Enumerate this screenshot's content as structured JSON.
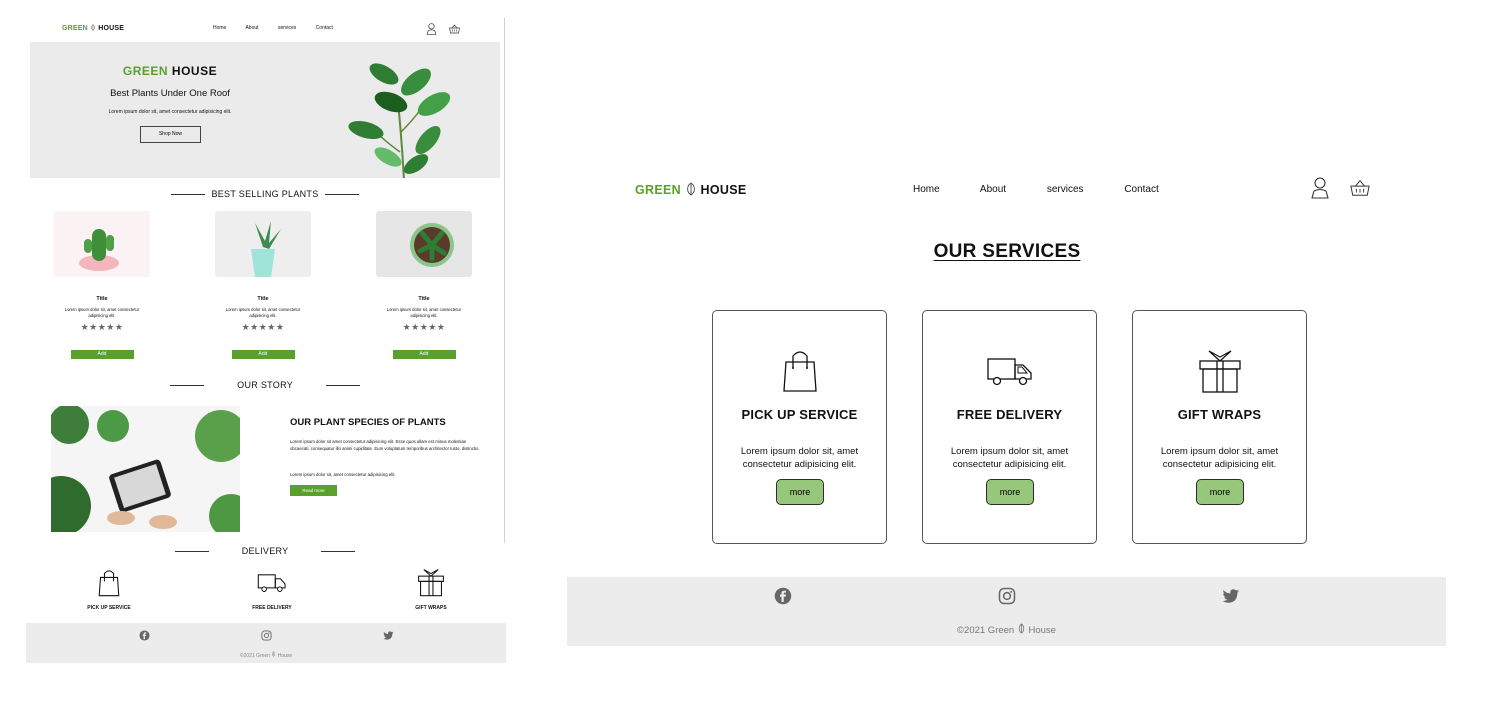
{
  "brand": {
    "green_word": "GREEN",
    "black_word": "HOUSE",
    "green_color": "#5aa02c"
  },
  "nav": {
    "links": [
      "Home",
      "About",
      "services",
      "Contact"
    ],
    "icons": [
      "user-icon",
      "basket-icon"
    ]
  },
  "home": {
    "hero": {
      "title_green": "GREEN",
      "title_black": "HOUSE",
      "subtitle": "Best Plants Under One Roof",
      "desc": "Lorem ipsum dolor sit, amet consectetur adipisicing elit.",
      "button": "Shop Now"
    },
    "best_selling_heading": "BEST SELLING PLANTS",
    "products": [
      {
        "title": "Title",
        "desc": "Lorem ipsum dolor sit, amet consectetur adipisicing elit.",
        "stars": "★★★★★",
        "button": "Add"
      },
      {
        "title": "Title",
        "desc": "Lorem ipsum dolor sit, amet consectetur adipisicing elit.",
        "stars": "★★★★★",
        "button": "Add"
      },
      {
        "title": "Title",
        "desc": "Lorem ipsum dolor sit, amet consectetur adipisicing elit.",
        "stars": "★★★★★",
        "button": "Add"
      }
    ],
    "story_heading": "OUR STORY",
    "story": {
      "title": "OUR PLANT SPECIES OF PLANTS",
      "p1": "Lorem ipsum dolor sit amet consectetur adipisicing elit. Esse quos ullam est minus molestiae obcaecati, consequatur illo animi cupiditate. Eum voluptatum temporibus architecto! Iusto, distinctio.",
      "p2": "Lorem ipsum dolor sit, amet consectetur adipisicing elit.",
      "button": "Read more"
    },
    "delivery_heading": "DELIVERY",
    "services": [
      "PICK UP SERVICE",
      "FREE DELIVERY",
      "GIFT WRAPS"
    ],
    "footer_copy_prefix": "©2021 Green",
    "footer_copy_suffix": "House"
  },
  "services_page": {
    "title": "OUR SERVICES",
    "cards": [
      {
        "icon": "shopping-bag-icon",
        "title": "PICK UP SERVICE",
        "desc": "Lorem ipsum dolor sit, amet consectetur adipisicing elit.",
        "button": "more"
      },
      {
        "icon": "truck-icon",
        "title": "FREE DELIVERY",
        "desc": "Lorem ipsum dolor sit, amet consectetur adipisicing elit.",
        "button": "more"
      },
      {
        "icon": "gift-icon",
        "title": "GIFT WRAPS",
        "desc": "Lorem ipsum dolor sit, amet consectetur adipisicing elit.",
        "button": "more"
      }
    ],
    "more_button_color": "#97c77a"
  },
  "footer": {
    "social_icons": [
      "facebook-icon",
      "instagram-icon",
      "twitter-icon"
    ],
    "copy_prefix": "©2021 Green",
    "copy_suffix": "House"
  }
}
